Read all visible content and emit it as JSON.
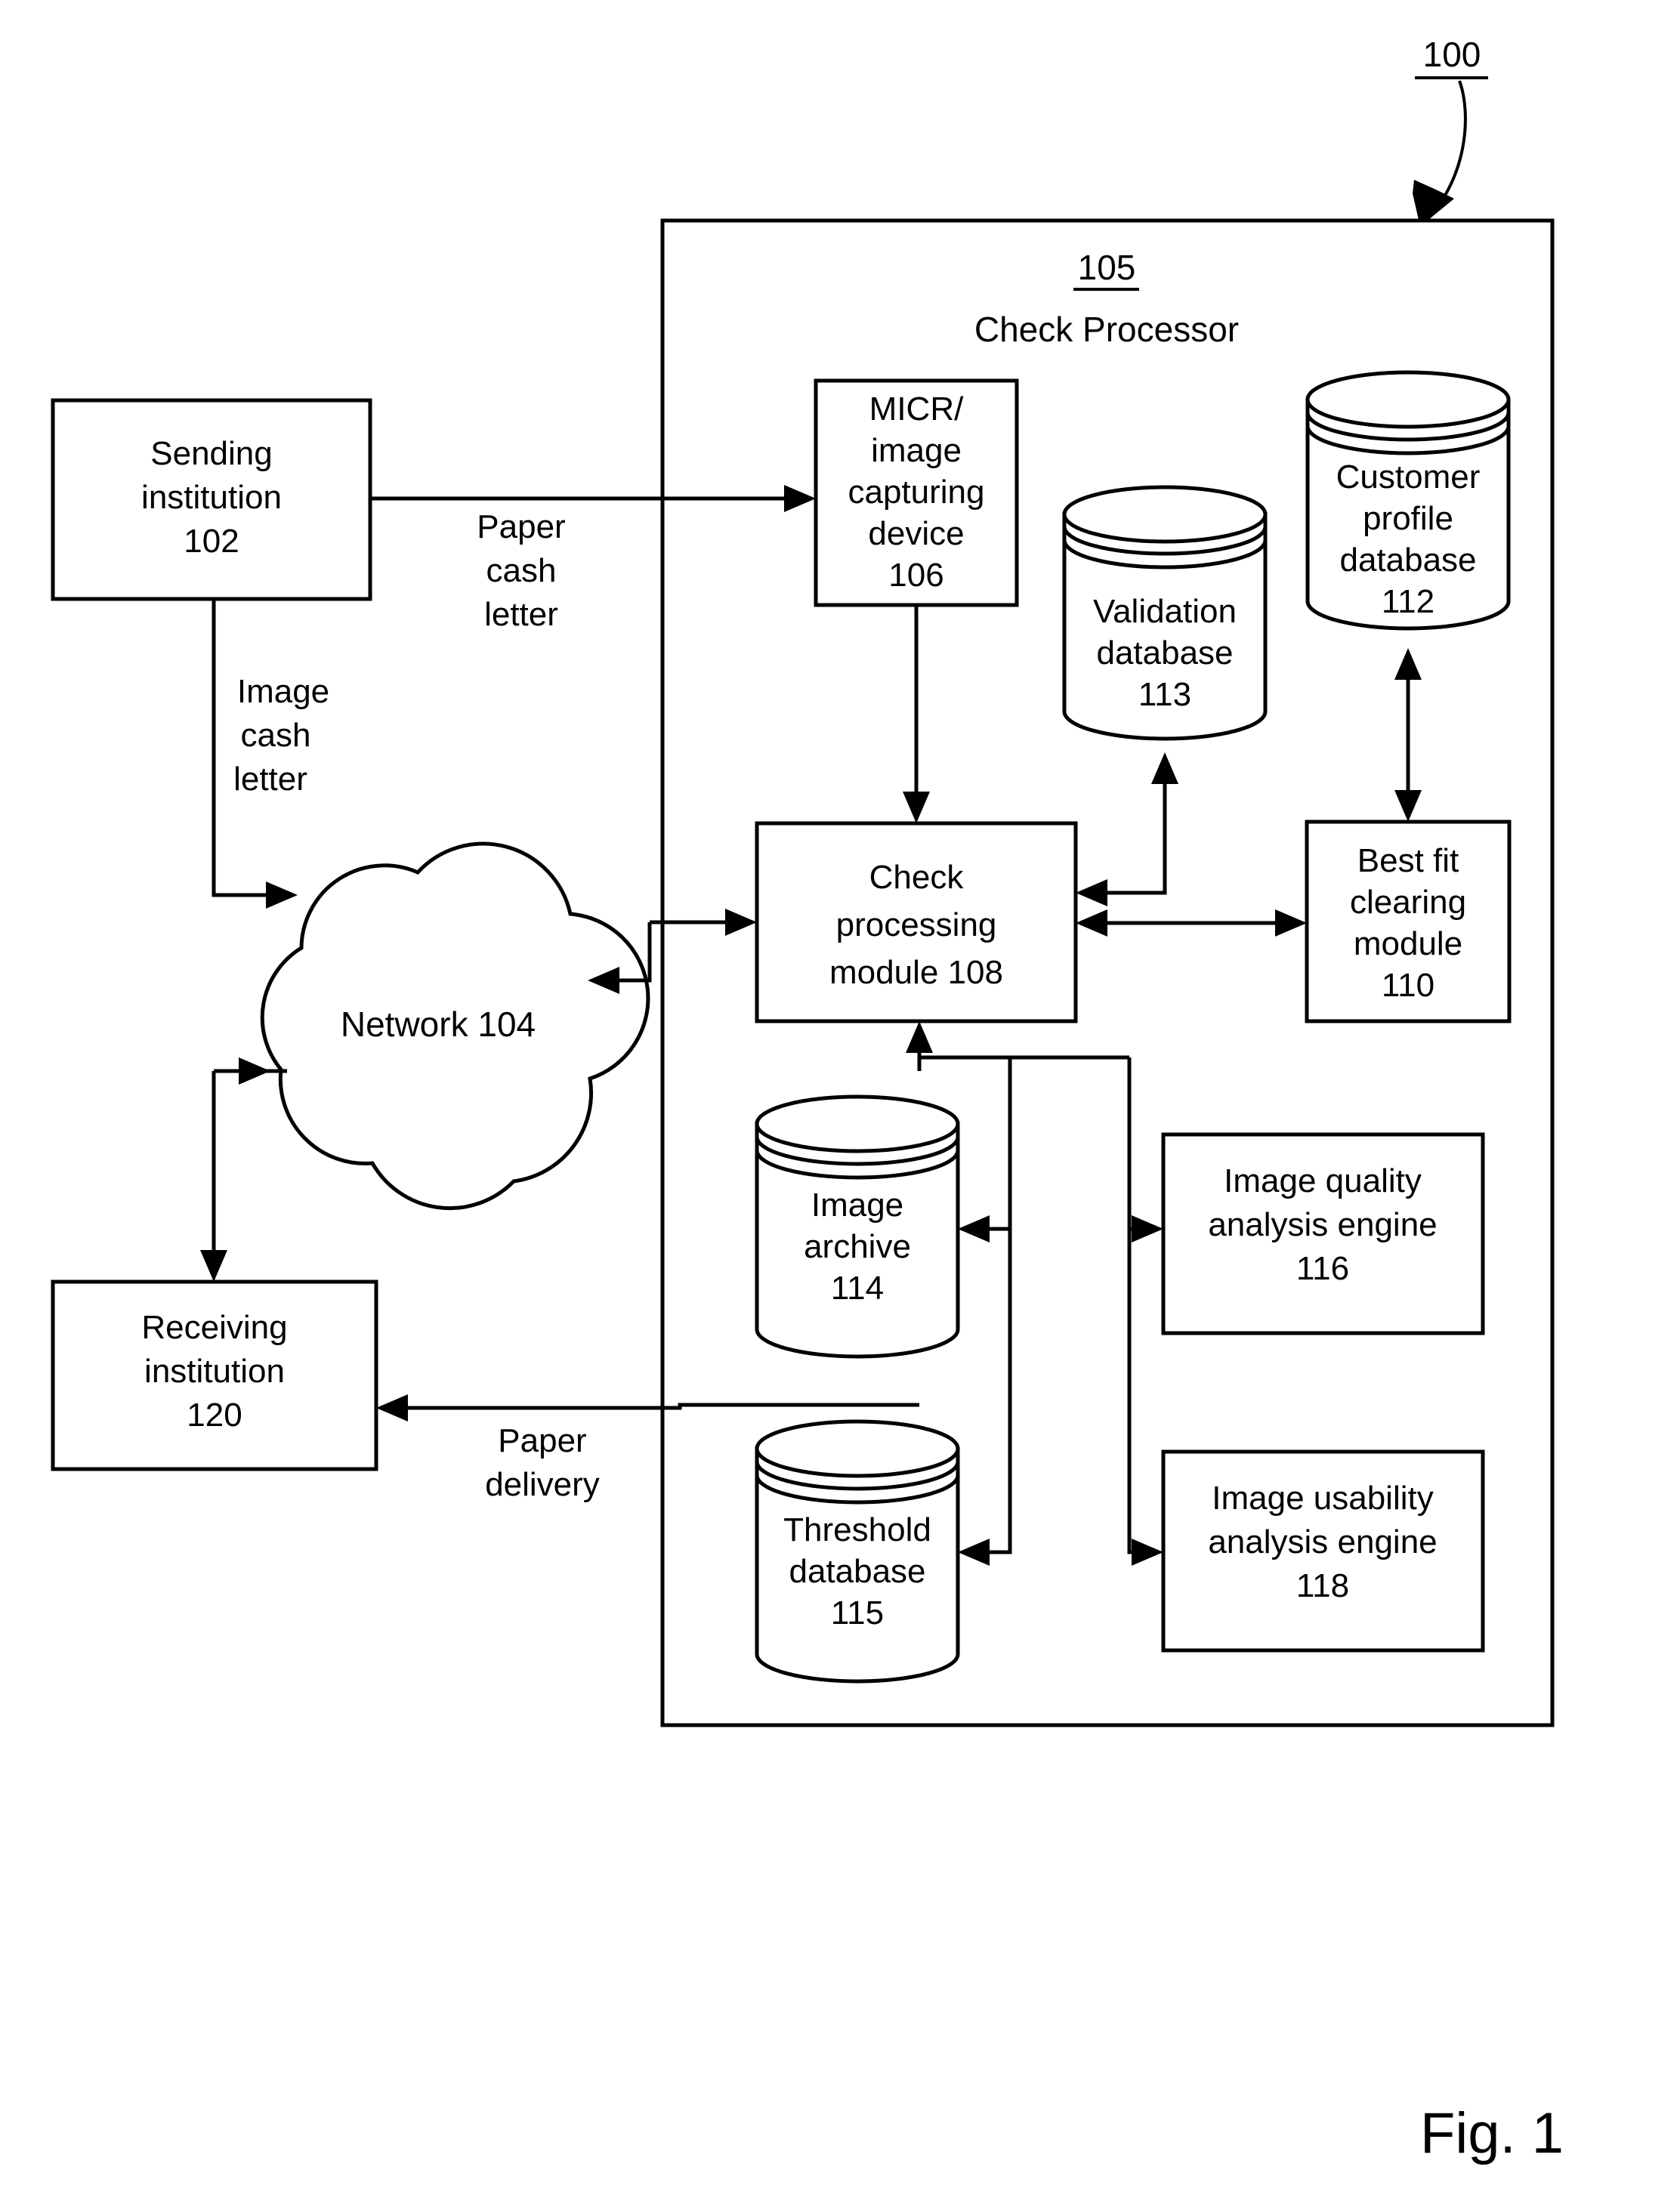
{
  "figure": {
    "caption": "Fig. 1",
    "system_ref": "100"
  },
  "container": {
    "ref": "105",
    "title": "Check Processor"
  },
  "nodes": {
    "sending_institution": {
      "line1": "Sending",
      "line2": "institution",
      "ref": "102"
    },
    "micr_device": {
      "line1": "MICR/",
      "line2": "image",
      "line3": "capturing",
      "line4": "device",
      "ref": "106"
    },
    "validation_database": {
      "line1": "Validation",
      "line2": "database",
      "ref": "113"
    },
    "customer_profile_database": {
      "line1": "Customer",
      "line2": "profile",
      "line3": "database",
      "ref": "112"
    },
    "check_processing_module": {
      "line1": "Check",
      "line2": "processing",
      "line3": "module 108"
    },
    "best_fit_clearing_module": {
      "line1": "Best fit",
      "line2": "clearing",
      "line3": "module",
      "ref": "110"
    },
    "network": {
      "label": "Network 104"
    },
    "receiving_institution": {
      "line1": "Receiving",
      "line2": "institution",
      "ref": "120"
    },
    "image_archive": {
      "line1": "Image",
      "line2": "archive",
      "ref": "114"
    },
    "threshold_database": {
      "line1": "Threshold",
      "line2": "database",
      "ref": "115"
    },
    "image_quality_engine": {
      "line1": "Image quality",
      "line2": "analysis engine",
      "ref": "116"
    },
    "image_usability_engine": {
      "line1": "Image usability",
      "line2": "analysis engine",
      "ref": "118"
    }
  },
  "edge_labels": {
    "paper_cash_letter": {
      "line1": "Paper",
      "line2": "cash",
      "line3": "letter"
    },
    "image_cash_letter": {
      "line1": "Image",
      "line2": "cash",
      "line3": "letter"
    },
    "paper_delivery": {
      "line1": "Paper",
      "line2": "delivery"
    }
  },
  "colors": {
    "stroke": "#000000",
    "background": "#ffffff"
  }
}
